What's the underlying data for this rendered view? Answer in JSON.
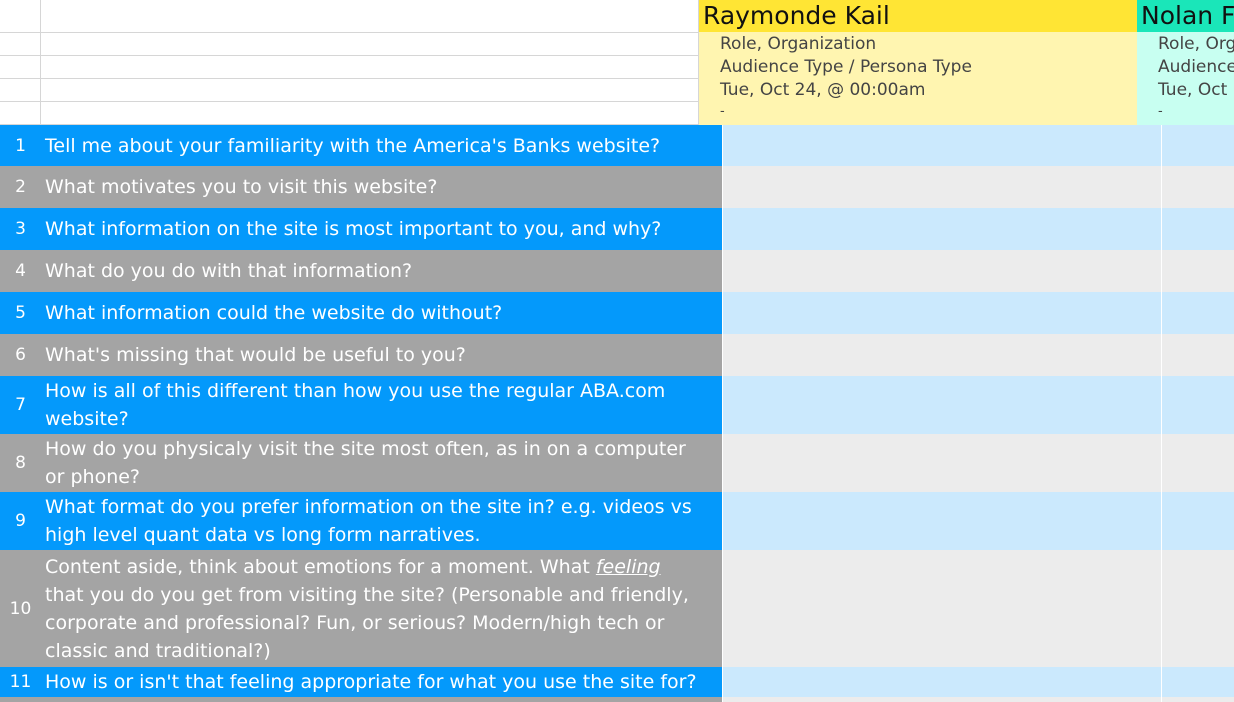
{
  "personas": [
    {
      "name": "Raymonde Kail",
      "role": "Role, Organization",
      "audience": "Audience Type / Persona Type",
      "date": "Tue, Oct 24, @ 00:00am",
      "dash": "-",
      "header_color": "#ffe534",
      "meta_color": "#fff5b0"
    },
    {
      "name": "Nolan F",
      "role": "Role, Org",
      "audience": "Audience",
      "date": "Tue, Oct",
      "dash": "-",
      "header_color": "#1ae6b9",
      "meta_color": "#c8fff1"
    }
  ],
  "questions": [
    {
      "num": "1",
      "text": "Tell me about your familiarity with the America's Banks website?"
    },
    {
      "num": "2",
      "text": "What motivates you to visit this website?"
    },
    {
      "num": "3",
      "text": "What information on the site is most important to you, and why?"
    },
    {
      "num": "4",
      "text": "What do you do with that information?"
    },
    {
      "num": "5",
      "text": "What information could the website do without?"
    },
    {
      "num": "6",
      "text": "What's missing that would be useful to you?"
    },
    {
      "num": "7",
      "text": "How is all of this different than how you use the regular ABA.com website?"
    },
    {
      "num": "8",
      "text": "How do you physicaly visit the site most often, as in on a computer or phone?"
    },
    {
      "num": "9",
      "text": "What format do you prefer information on the site in? e.g. videos vs high level quant data vs long form narratives."
    },
    {
      "num": "10",
      "text_before": "Content aside, think about emotions for a moment. What ",
      "text_emph": "feeling",
      "text_after": " that you do you get from visiting the site? (Personable and friendly, corporate and professional? Fun, or serious? Modern/high tech or classic and traditional?)"
    },
    {
      "num": "11",
      "text": "How is or isn't that feeling appropriate for what you use the site for?"
    }
  ],
  "colors": {
    "row_blue": "#0499fb",
    "row_gray": "#a4a4a4",
    "cell_blue": "#cbe9fd",
    "cell_gray": "#ececec"
  }
}
